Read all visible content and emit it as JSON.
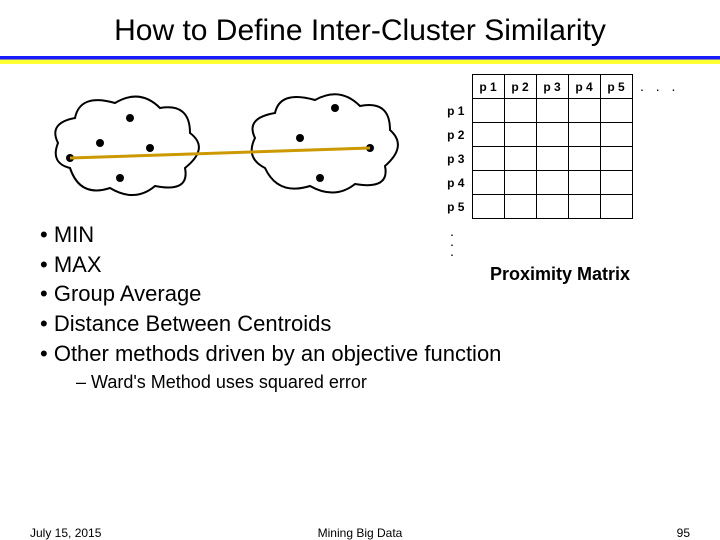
{
  "title": "How to Define Inter-Cluster Similarity",
  "matrix": {
    "cols": [
      "p 1",
      "p 2",
      "p 3",
      "p 4",
      "p 5"
    ],
    "rows": [
      "p 1",
      "p 2",
      "p 3",
      "p 4",
      "p 5"
    ],
    "hdots": ". . .",
    "caption": "Proximity Matrix"
  },
  "bullets": {
    "b1": "MIN",
    "b2": "MAX",
    "b3": "Group Average",
    "b4": "Distance Between Centroids",
    "b5": "Other methods driven by an objective function",
    "sub1": "Ward's Method uses squared error"
  },
  "footer": {
    "date": "July 15, 2015",
    "center": "Mining Big Data",
    "page": "95"
  }
}
